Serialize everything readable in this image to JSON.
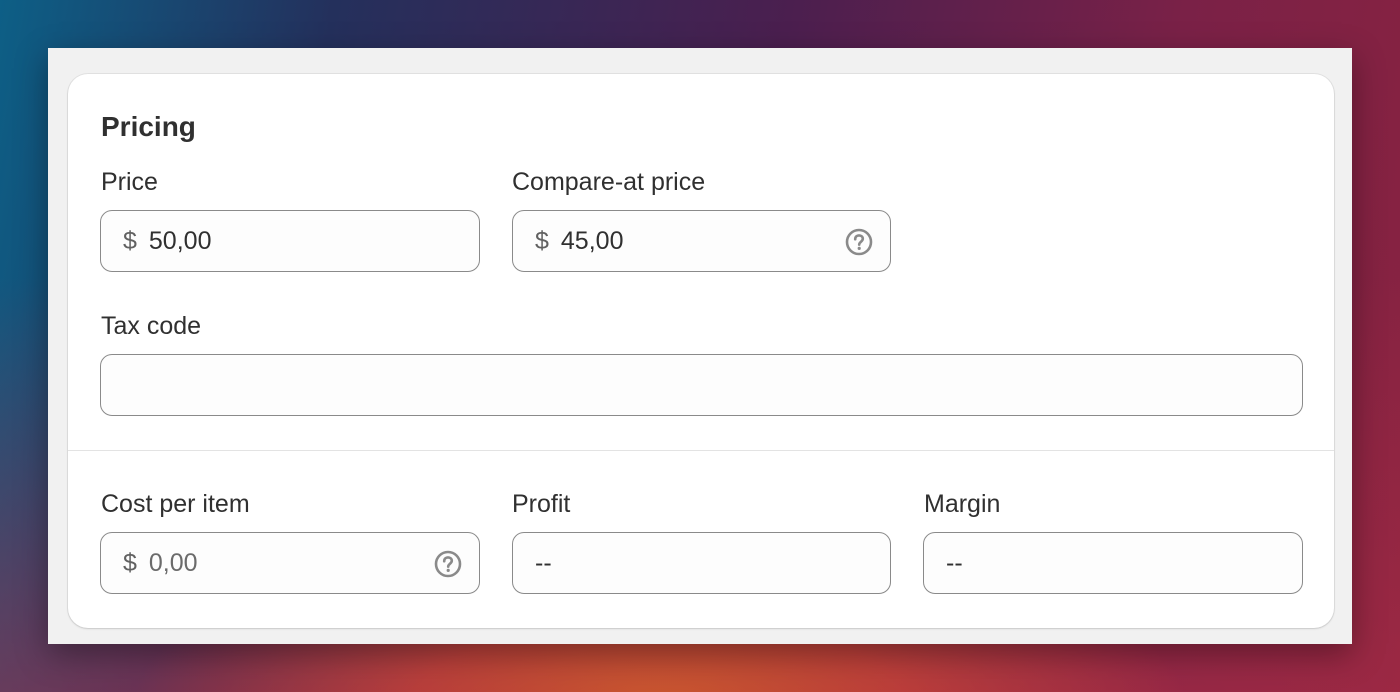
{
  "pricing": {
    "title": "Pricing",
    "price": {
      "label": "Price",
      "prefix": "$",
      "value": "50,00"
    },
    "compare_at_price": {
      "label": "Compare-at price",
      "prefix": "$",
      "value": "45,00",
      "help_icon": "question-circle-icon"
    },
    "tax_code": {
      "label": "Tax code",
      "value": ""
    }
  },
  "cost": {
    "cost_per_item": {
      "label": "Cost per item",
      "prefix": "$",
      "placeholder": "0,00",
      "help_icon": "question-circle-icon"
    },
    "profit": {
      "label": "Profit",
      "value": "--"
    },
    "margin": {
      "label": "Margin",
      "value": "--"
    }
  },
  "colors": {
    "text": "#303030",
    "border": "#8a8a8a",
    "card": "#ffffff"
  }
}
